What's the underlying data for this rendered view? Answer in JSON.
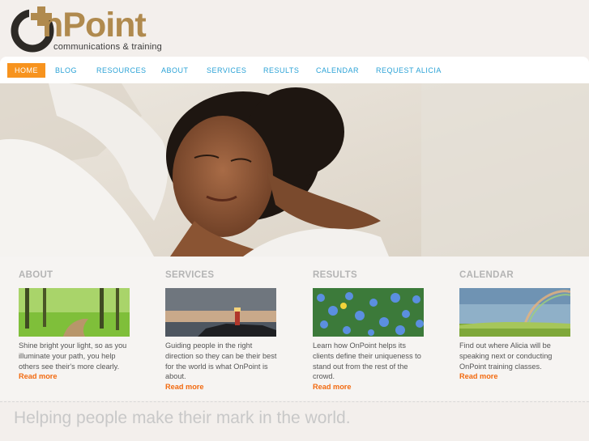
{
  "brand": {
    "name": "OnPoint",
    "name_suffix": "nPoint",
    "tagline": "communications & training",
    "colors": {
      "gold": "#b08a4e",
      "dark": "#2d2a26",
      "orange": "#f7931e",
      "link_blue": "#2aa2d6",
      "read_more": "#f26a10"
    }
  },
  "nav": {
    "items": [
      {
        "label": "HOME",
        "active": true
      },
      {
        "label": "BLOG"
      },
      {
        "label": "RESOURCES"
      },
      {
        "label": "ABOUT"
      },
      {
        "label": "SERVICES"
      },
      {
        "label": "RESULTS"
      },
      {
        "label": "CALENDAR"
      },
      {
        "label": "REQUEST ALICIA"
      }
    ]
  },
  "hero": {
    "image": "woman-relaxing-on-carpet"
  },
  "columns": [
    {
      "title": "ABOUT",
      "image": "forest-path",
      "text": "Shine bright your light, so as you illuminate your path, you help others see their's more clearly.",
      "more": "Read more"
    },
    {
      "title": "SERVICES",
      "image": "lighthouse-at-dusk",
      "text": "Guiding people in the right direction so they can be their best for the world is what OnPoint is about.",
      "more": "Read more"
    },
    {
      "title": "RESULTS",
      "image": "blue-flowers-yellow-flower",
      "text": "Learn how OnPoint helps its clients define their uniqueness to stand out from the rest of the crowd.",
      "more": "Read more"
    },
    {
      "title": "CALENDAR",
      "image": "rainbow-over-field",
      "text": "Find out where Alicia will be speaking next or conducting OnPoint training classes.",
      "more": "Read more"
    }
  ],
  "footer": {
    "tagline": "Helping people make their mark in the world."
  }
}
